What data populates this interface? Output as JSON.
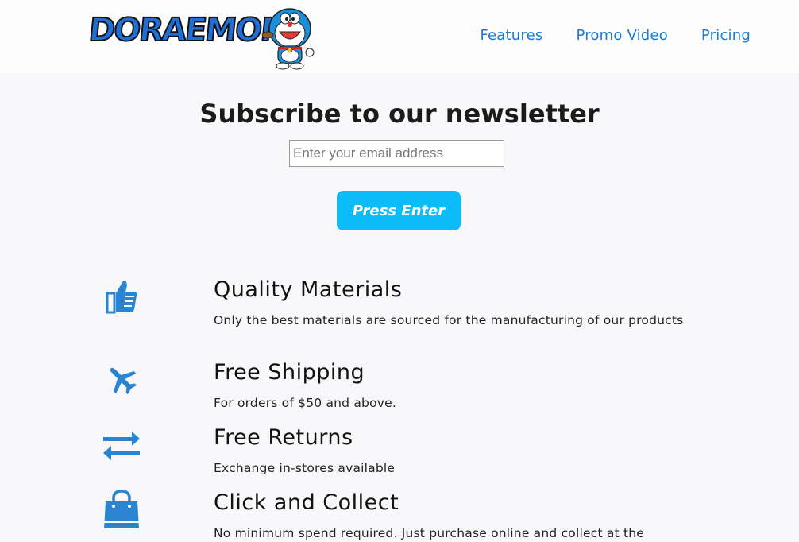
{
  "header": {
    "logo_text": "DORAEMON",
    "nav": [
      {
        "label": "Features"
      },
      {
        "label": "Promo Video"
      },
      {
        "label": "Pricing"
      }
    ]
  },
  "newsletter": {
    "title": "Subscribe to our newsletter",
    "email_placeholder": "Enter your email address",
    "submit_label": "Press Enter"
  },
  "features": [
    {
      "icon": "thumbs-up-icon",
      "title": "Quality Materials",
      "description": "Only the best materials are sourced for the manufacturing of our products"
    },
    {
      "icon": "plane-icon",
      "title": "Free Shipping",
      "description": "For orders of $50 and above."
    },
    {
      "icon": "exchange-arrows-icon",
      "title": "Free Returns",
      "description": "Exchange in-stores available"
    },
    {
      "icon": "shopping-bag-icon",
      "title": "Click and Collect",
      "description": "No minimum spend required. Just purchase online and collect at the"
    }
  ],
  "colors": {
    "accent": "#1a7ad6",
    "button": "#0bbcf8",
    "icon": "#2a84cf",
    "background": "#f8f8fb"
  }
}
